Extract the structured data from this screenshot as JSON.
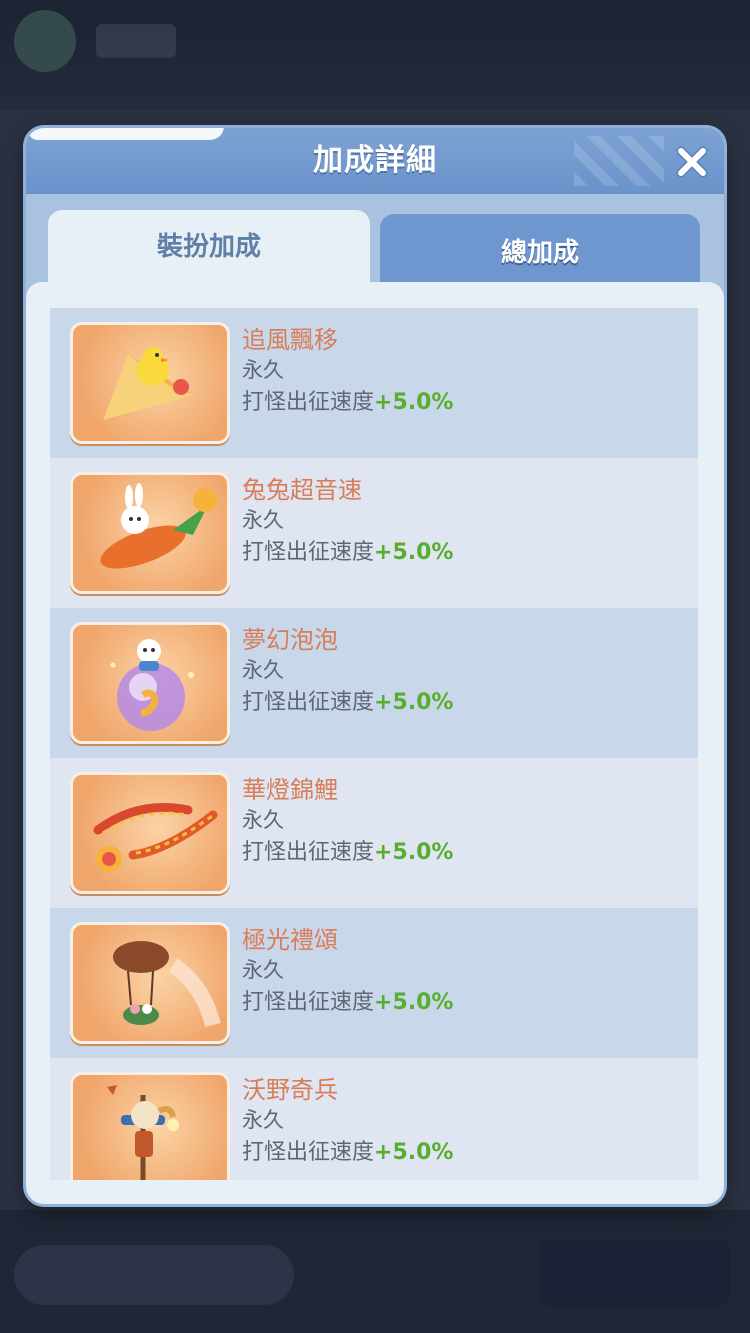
{
  "modal": {
    "title": "加成詳細",
    "tabs": [
      {
        "label": "裝扮加成",
        "active": true
      },
      {
        "label": "總加成",
        "active": false
      }
    ]
  },
  "items": [
    {
      "name": "追風飄移",
      "duration": "永久",
      "bonus_label": "打怪出征速度",
      "bonus_value": "+5.0%",
      "icon": "kite-chick-icon"
    },
    {
      "name": "兔兔超音速",
      "duration": "永久",
      "bonus_label": "打怪出征速度",
      "bonus_value": "+5.0%",
      "icon": "bunny-rocket-icon"
    },
    {
      "name": "夢幻泡泡",
      "duration": "永久",
      "bonus_label": "打怪出征速度",
      "bonus_value": "+5.0%",
      "icon": "bubble-bear-icon"
    },
    {
      "name": "華燈錦鯉",
      "duration": "永久",
      "bonus_label": "打怪出征速度",
      "bonus_value": "+5.0%",
      "icon": "koi-lantern-icon"
    },
    {
      "name": "極光禮頌",
      "duration": "永久",
      "bonus_label": "打怪出征速度",
      "bonus_value": "+5.0%",
      "icon": "airship-icon"
    },
    {
      "name": "沃野奇兵",
      "duration": "永久",
      "bonus_label": "打怪出征速度",
      "bonus_value": "+5.0%",
      "icon": "scarecrow-icon"
    }
  ],
  "colors": {
    "name_text": "#d97d58",
    "bonus_value": "#5aae2f",
    "header": "#7da2d4",
    "panel": "#e7f0f6"
  }
}
